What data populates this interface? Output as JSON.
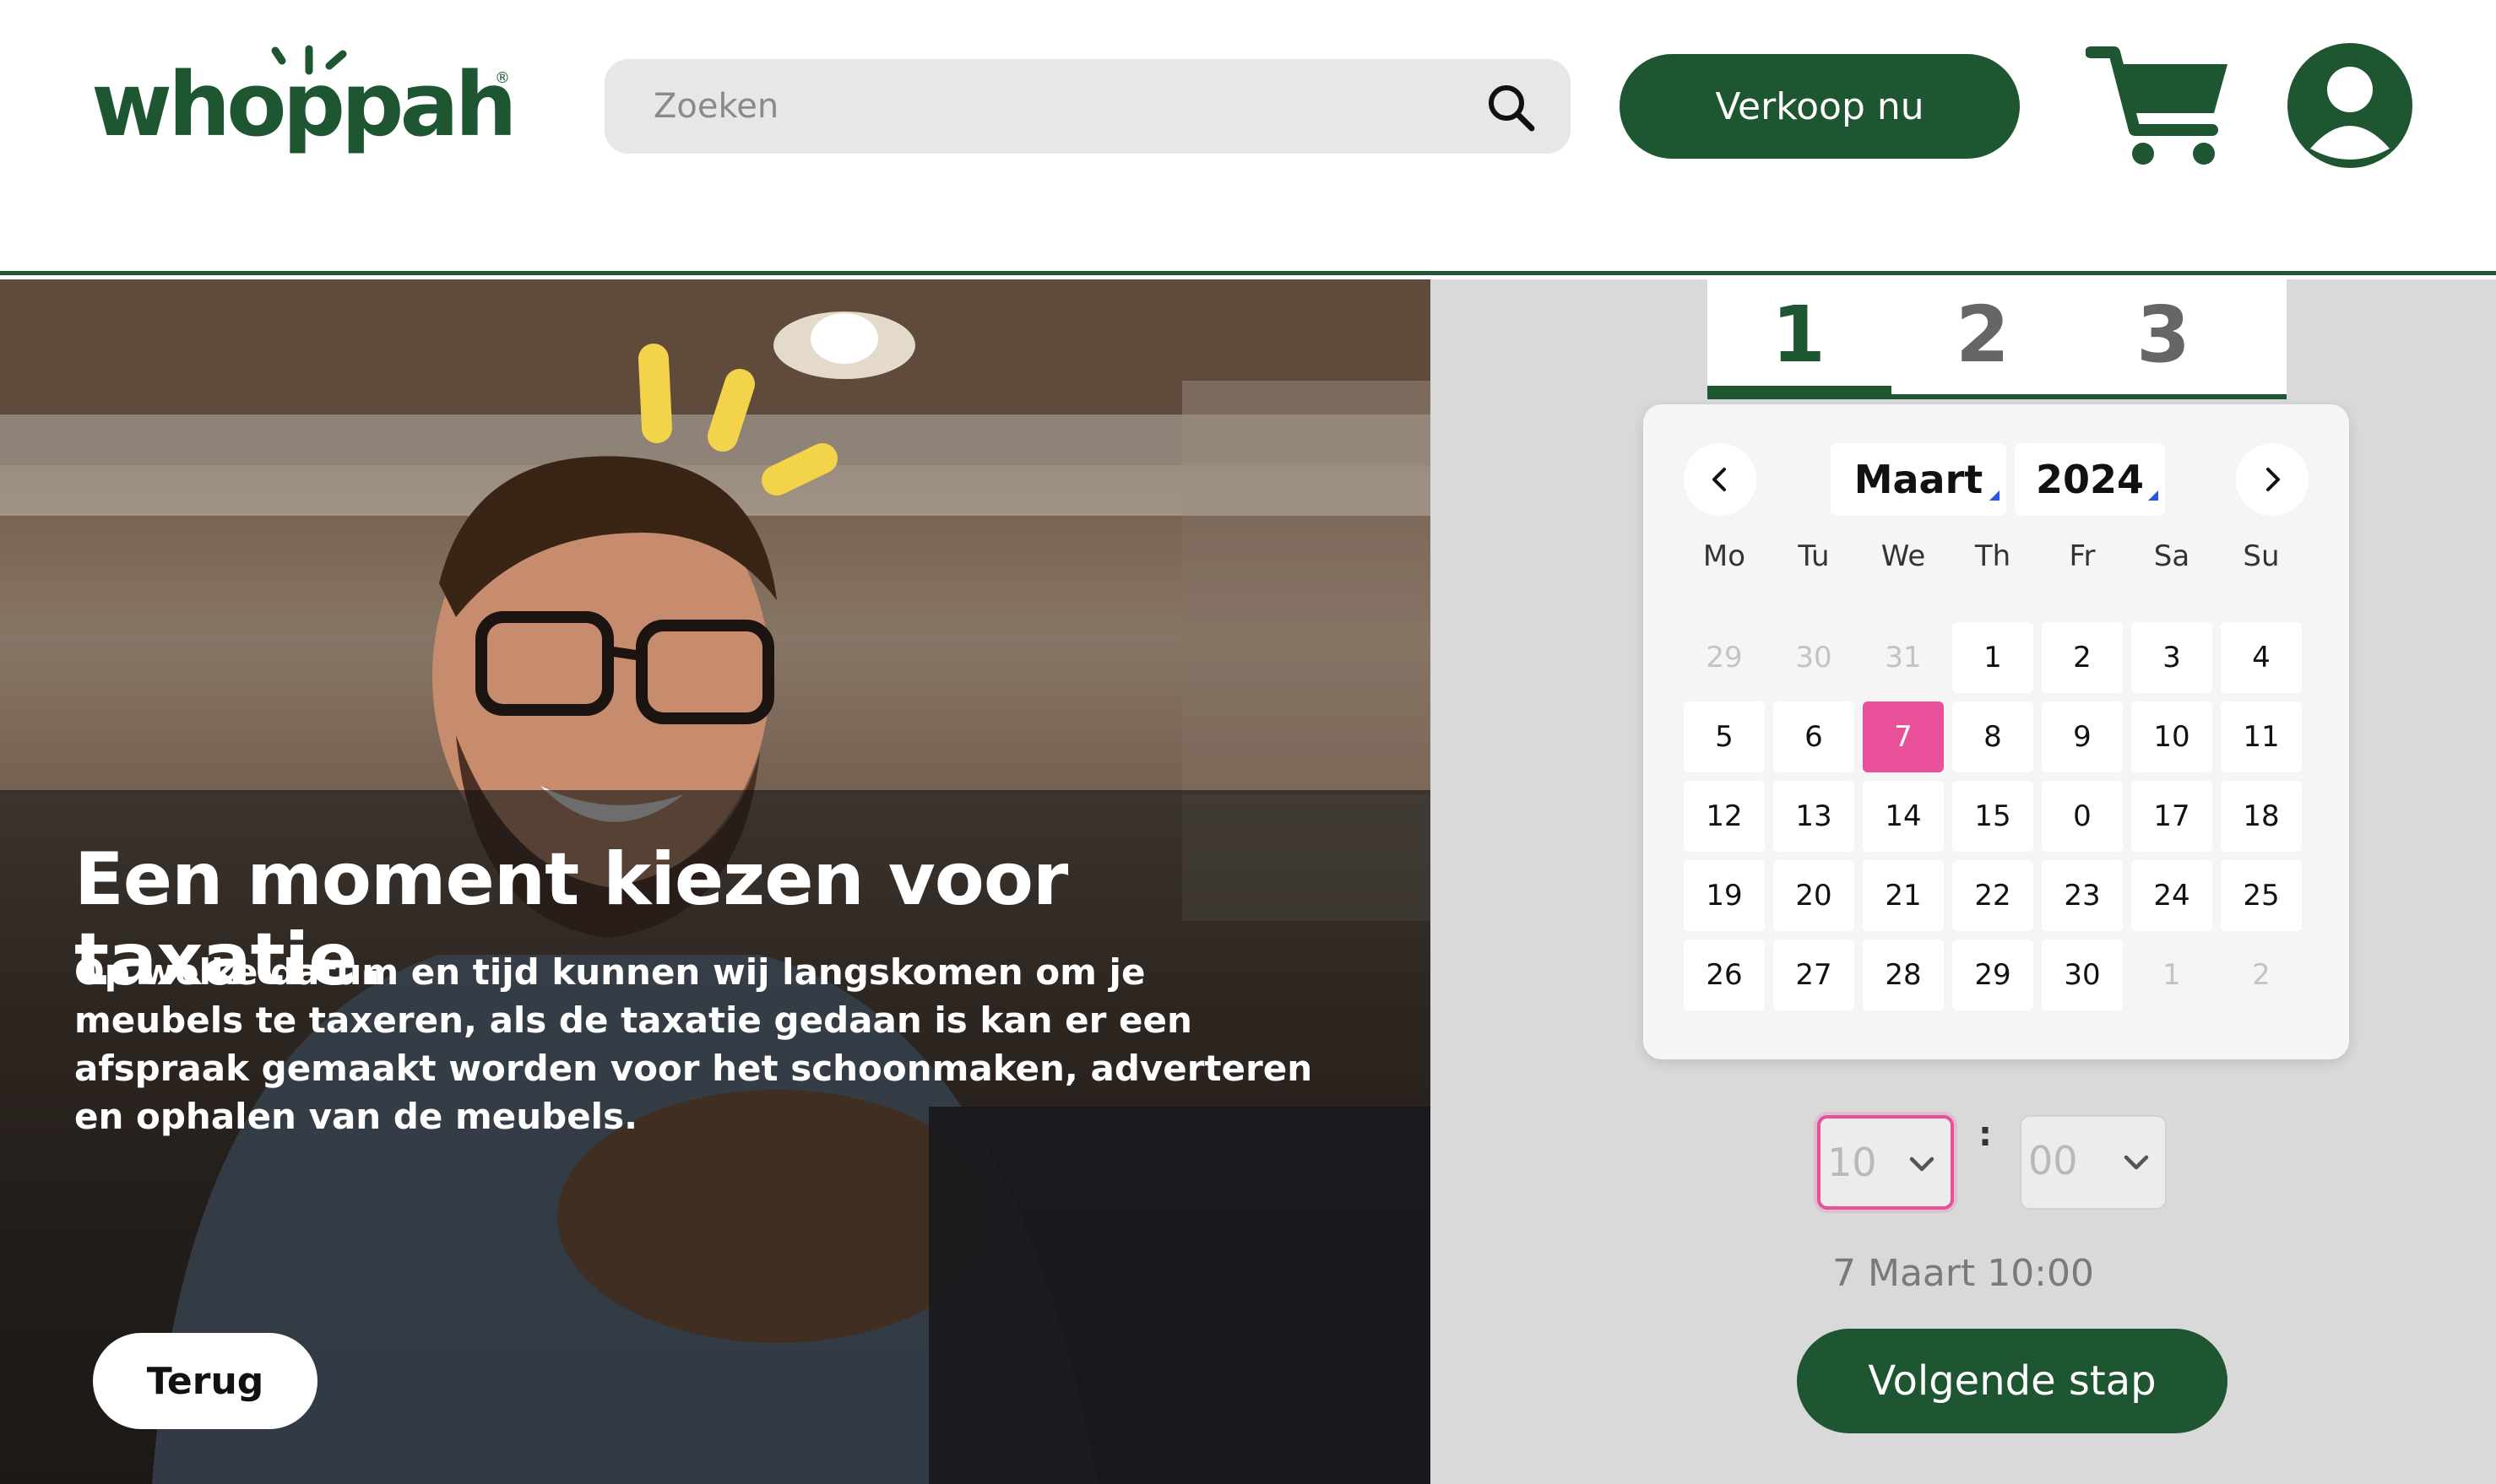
{
  "header": {
    "logo_text": "whoppah",
    "logo_mark": "®",
    "search_placeholder": "Zoeken",
    "sell_label": "Verkoop nu"
  },
  "hero": {
    "title": "Een moment kiezen voor taxatie.",
    "description": "Op welke datum en tijd kunnen wij langskomen om je meubels te taxeren, als de taxatie gedaan is kan er een afspraak gemaakt worden voor het schoonmaken, adverteren en ophalen van de meubels.",
    "back_label": "Terug"
  },
  "steps": [
    {
      "label": "1",
      "active": true
    },
    {
      "label": "2",
      "active": false
    },
    {
      "label": "3",
      "active": false
    }
  ],
  "calendar": {
    "month": "Maart",
    "year": "2024",
    "weekdays": [
      "Mo",
      "Tu",
      "We",
      "Th",
      "Fr",
      "Sa",
      "Su"
    ],
    "weeks": [
      [
        "29",
        "30",
        "31",
        "1",
        "2",
        "3",
        "4"
      ],
      [
        "5",
        "6",
        "7",
        "8",
        "9",
        "10",
        "11"
      ],
      [
        "12",
        "13",
        "14",
        "15",
        "0",
        "17",
        "18"
      ],
      [
        "19",
        "20",
        "21",
        "22",
        "23",
        "24",
        "25"
      ],
      [
        "26",
        "27",
        "28",
        "29",
        "30",
        "1",
        "2"
      ]
    ],
    "selected_day": "7"
  },
  "time": {
    "hour": "10",
    "minute": "00",
    "separator": ":"
  },
  "summary": "7 Maart 10:00",
  "next_label": "Volgende stap",
  "colors": {
    "brand_green": "#1e5631",
    "selected_pink": "#e8509a",
    "accent_yellow": "#f2d34a"
  }
}
